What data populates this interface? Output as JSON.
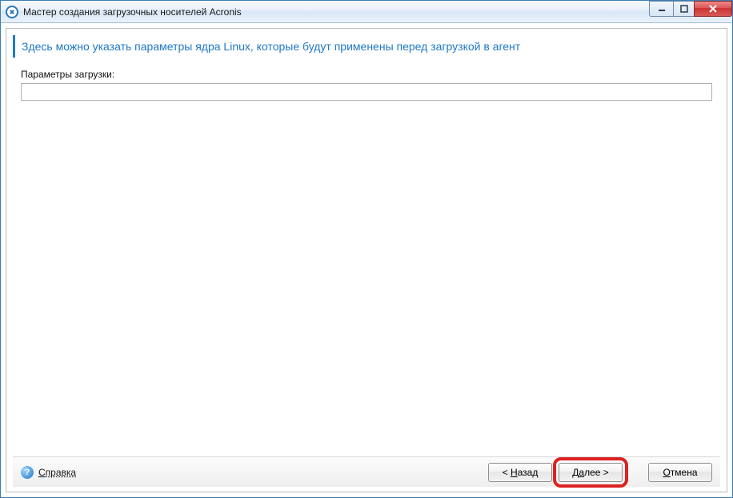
{
  "window": {
    "title": "Мастер создания загрузочных носителей Acronis"
  },
  "page": {
    "headline": "Здесь можно указать параметры ядра Linux, которые будут применены перед загрузкой в агент",
    "params_label": "Параметры загрузки:",
    "params_value": ""
  },
  "footer": {
    "help_prefix": "С",
    "help_rest": "правка",
    "back_lt": "< ",
    "back_u": "Н",
    "back_rest": "азад",
    "next_prefix": "Д",
    "next_u": "а",
    "next_rest": "лее >",
    "cancel_u": "О",
    "cancel_rest": "тмена"
  }
}
